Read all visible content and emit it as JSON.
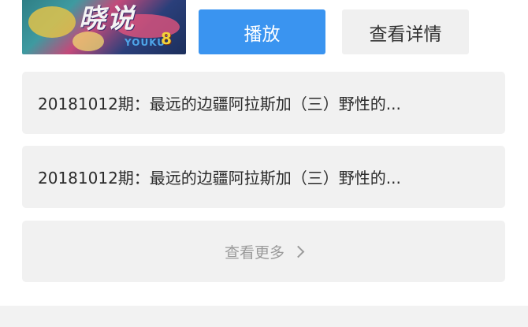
{
  "thumbnail": {
    "show_title": "晓说",
    "brand": "YOUKU",
    "episode_badge": "8"
  },
  "actions": {
    "play_label": "播放",
    "detail_label": "查看详情"
  },
  "episodes": [
    {
      "title": "20181012期：最远的边疆阿拉斯加（三）野性的..."
    },
    {
      "title": "20181012期：最远的边疆阿拉斯加（三）野性的..."
    }
  ],
  "more": {
    "label": "查看更多"
  },
  "colors": {
    "primary": "#3a94f0",
    "card_bg": "#f1f1f1",
    "muted_text": "#9a9a9a"
  }
}
